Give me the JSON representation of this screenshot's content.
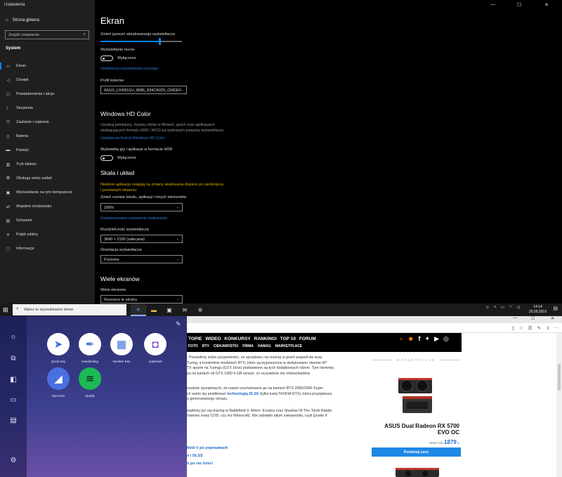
{
  "settings": {
    "window_title": "Ustawienia",
    "home": "Strona główna",
    "search_placeholder": "Znajdź ustawienie",
    "section": "System",
    "nav": [
      {
        "label": "Ekran",
        "icon": "monitor-icon"
      },
      {
        "label": "Dźwięk",
        "icon": "speaker-icon"
      },
      {
        "label": "Powiadomienia i akcje",
        "icon": "notification-icon"
      },
      {
        "label": "Skupienie",
        "icon": "moon-icon"
      },
      {
        "label": "Zasilanie i uśpienie",
        "icon": "power-icon"
      },
      {
        "label": "Bateria",
        "icon": "battery-icon"
      },
      {
        "label": "Pamięć",
        "icon": "storage-icon"
      },
      {
        "label": "Tryb tabletu",
        "icon": "tablet-icon"
      },
      {
        "label": "Obsługa wielu zadań",
        "icon": "multitask-icon"
      },
      {
        "label": "Wyświetlanie na tym komputerze",
        "icon": "project-icon"
      },
      {
        "label": "Wspólne środowisko",
        "icon": "shared-icon"
      },
      {
        "label": "Schowek",
        "icon": "clipboard-icon"
      },
      {
        "label": "Pulpit zdalny",
        "icon": "remote-icon"
      },
      {
        "label": "Informacje",
        "icon": "info-icon"
      }
    ],
    "page_title": "Ekran",
    "brightness_label": "Zmień jasność wbudowanego wyświetlacza",
    "brightness_level": 0.72,
    "night_light_label": "Wyświetlanie nocne",
    "night_light_state": "Wyłączone",
    "night_light_link": "Ustawienia wyświetlania nocnego",
    "color_profile_label": "Profil kolorów",
    "color_profile_value": "ASUS_UX581GV_8086_834CA029_CMDEF",
    "hdr_heading": "Windows HD Color",
    "hdr_desc_1": "Uzyskaj jaśniejszy, żywszy obraz w filmach, grach oraz aplikacjach",
    "hdr_desc_2": "obsługujących formaty HDR i WCG na wybranym powyżej wyświetlaczu",
    "hdr_link": "Ustawienia funkcji Windows HD Color",
    "hdr_toggle_label": "Wyświetlaj gry i aplikacje w formacie HDR",
    "hdr_toggle_state": "Wyłączone",
    "scale_heading": "Skala i układ",
    "scale_warn_1": "Niektóre aplikacje reagują na zmiany skalowania dopiero po zamknięciu",
    "scale_warn_2": "i ponownym otwarciu",
    "scale_label": "Zmień rozmiar tekstu, aplikacji i innych elementów",
    "scale_value": "200%",
    "scale_link": "Zaawansowane ustawienia skalowania",
    "resolution_label": "Rozdzielczość wyświetlacza",
    "resolution_value": "3840 × 2160 (zalecana)",
    "orientation_label": "Orientacja wyświetlacza",
    "orientation_value": "Pozioma",
    "multi_heading": "Wiele ekranów",
    "multi_label": "Wiele ekranów",
    "multi_value": "Rozszerz te ekrany"
  },
  "taskbar": {
    "search_placeholder": "Wpisz tu wyszukiwane słowo",
    "time": "14:14",
    "date": "26.09.2019"
  },
  "asus": {
    "tiles": [
      {
        "label": "Quick Key",
        "icon": "paper-plane-icon",
        "bg": "#ffffff",
        "fg": "#3b6fd8"
      },
      {
        "label": "Handwriting",
        "icon": "pen-icon",
        "bg": "#ffffff",
        "fg": "#3b6fd8"
      },
      {
        "label": "Number Key",
        "icon": "numpad-icon",
        "bg": "#ffffff",
        "fg": "#3b6fd8"
      },
      {
        "label": "AppDeals",
        "icon": "shopping-bag-icon",
        "bg": "#ffffff",
        "fg": "#7b3fd0"
      },
      {
        "label": "MyASUS",
        "icon": "myasus-icon",
        "bg": "#4a6fe0",
        "fg": "#ffffff"
      },
      {
        "label": "Spotify",
        "icon": "spotify-icon",
        "bg": "#1db954",
        "fg": "#111111"
      }
    ]
  },
  "site": {
    "nav1": [
      "TOPIE",
      "WIDEO",
      "KONKURSY",
      "RANKINGI",
      "TOP 10",
      "FORUM"
    ],
    "nav2": [
      "FOTO",
      "RTV",
      "CIEKAWOSTKI",
      "FIRMA",
      "HAMAG",
      "MARKETPLACE"
    ],
    "p1_lines": [
      ". Pozwolimy sobie przypomnieć, że sprzętowy ray-tracing w grach pojawił się wraz",
      "Turing, a konkretnie modelach RTX, które są wyposażone w dedykowane rdzenie RT",
      "TX oparte na Turingu (GTX 16xx) pozbawione są tych dodatkowych rdzeni. Tym niemniej",
      "pu na kartach od GTX 1060 6 GB wzwyż, co oczywiście nie omieszkaliśmy"
    ],
    "p2_line1": "osobów sprzętowych, że nawet uruchamianie go na kartach RTX 2060/2060 Super",
    "p2_line2a": "ch warto się posiłkować ",
    "p2_link": "technologią DLSS",
    "p2_line2b": " (tylko karty NVIDIA RTX), która przyśpiesza",
    "p2_line3": "u generowanego obrazu.",
    "p3_lines": [
      "waliśmy już ray-tracing w Battlefield V, Metro: Exodus oraz Shadow Of The Tomb Raider",
      "równiez nowy COD, czy też Minecraft). Nie zabrakło także ciekawostki, czyli Quake II"
    ],
    "links": [
      "field V po poprawkach",
      "n i DLSS",
      "n po raz trzeci"
    ],
    "marketplace": "MARKETPLACE",
    "product": "ASUS Dual Radeon RX 5700 EVO OC",
    "price_label": "CENA OD",
    "price": "1879",
    "currency": "zł",
    "buy_label": "Porównaj ceny"
  },
  "colors": {
    "accent": "#0a84ff",
    "link": "#2a7fd9",
    "warn": "#d9b200"
  }
}
